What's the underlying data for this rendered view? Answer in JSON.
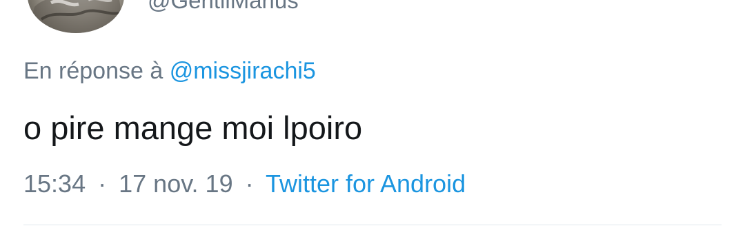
{
  "author": {
    "handle": "@GentilMarius"
  },
  "reply": {
    "prefix": "En réponse à",
    "mention": "@missjirachi5"
  },
  "tweet": {
    "text": "o pire mange moi lpoiro"
  },
  "meta": {
    "time": "15:34",
    "separator": "·",
    "date": "17 nov. 19",
    "source": "Twitter for Android"
  },
  "colors": {
    "text": "#14171a",
    "secondary": "#687684",
    "link": "#1b95e0",
    "divider": "#e1e8ed"
  }
}
